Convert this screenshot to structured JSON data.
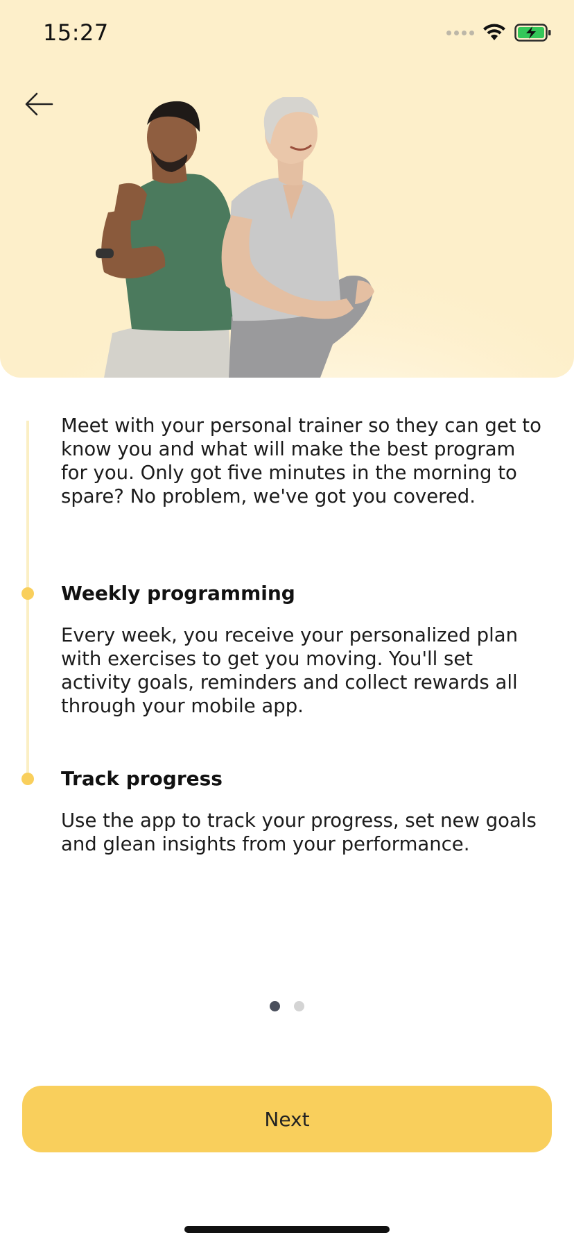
{
  "status_bar": {
    "time": "15:27"
  },
  "icons": {
    "back": "arrow-left-icon",
    "wifi": "wifi-icon",
    "battery": "battery-charging-icon",
    "signal": "cellular-signal-icon"
  },
  "colors": {
    "hero_background": "#fdefca",
    "accent": "#f9cf5c",
    "timeline": "#fbefc4",
    "pager_active": "#4a4f5c",
    "pager_inactive": "#d4d4d4"
  },
  "steps": [
    {
      "heading": "",
      "text": "Meet with your personal trainer so they can get to know you and what will make the best program for you. Only got five minutes in the morning to spare? No problem, we've got you covered."
    },
    {
      "heading": "Weekly programming",
      "text": "Every week, you receive your personalized plan with exercises to get you moving. You'll set activity goals, reminders and collect rewards all through your mobile app."
    },
    {
      "heading": "Track progress",
      "text": "Use the app to track your progress, set new goals and glean insights from your performance."
    }
  ],
  "pagination": {
    "current_page": 1,
    "total_pages": 2
  },
  "next_button": {
    "label": "Next"
  }
}
